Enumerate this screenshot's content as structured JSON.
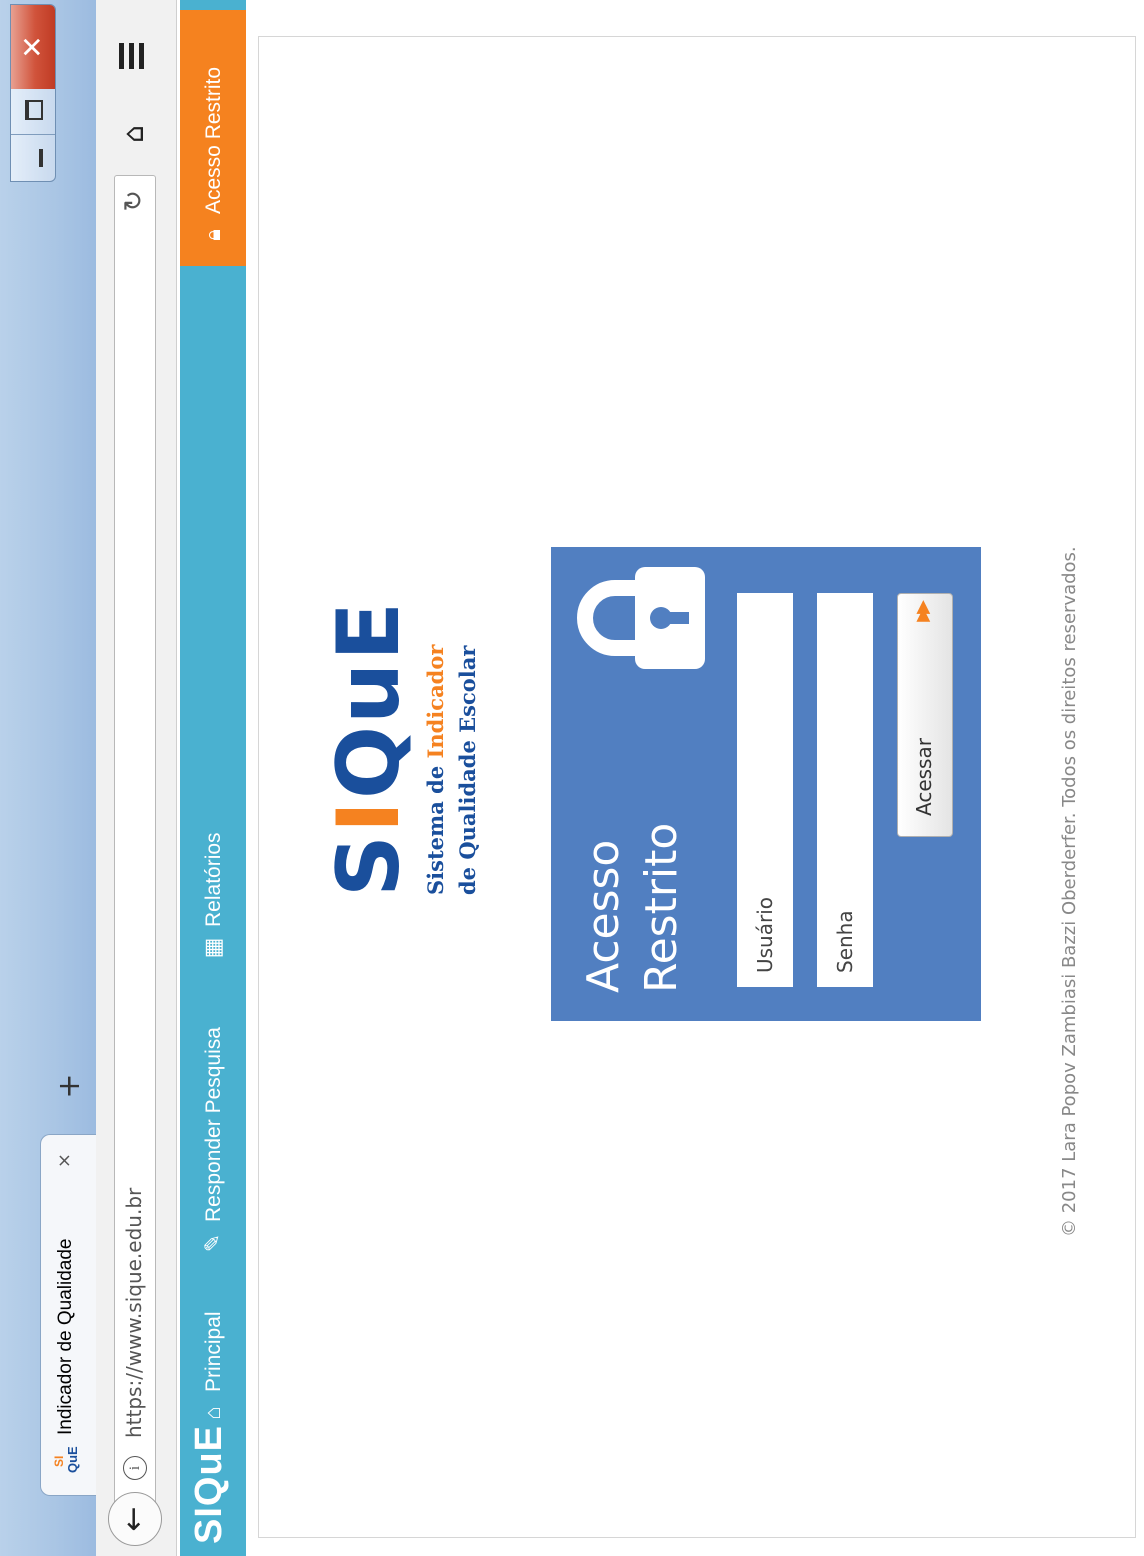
{
  "browser": {
    "tab": {
      "favicon_top": "SI",
      "favicon_bottom": "QuE",
      "title": "Indicador de Qualidade",
      "close_glyph": "×"
    },
    "new_tab_glyph": "+",
    "url": "https://www.sique.edu.br"
  },
  "site": {
    "logo": "SIQuE",
    "nav": {
      "principal": "Principal",
      "pesquisa": "Responder Pesquisa",
      "relatorios": "Relatórios",
      "restrito": "Acesso Restrito"
    }
  },
  "brand": {
    "logo_s": "S",
    "logo_i": "I",
    "logo_que": "QuE",
    "line1_pre": "Sistema de ",
    "line1_highlight": "Indicador",
    "line2": "de Qualidade Escolar"
  },
  "login": {
    "title_line1": "Acesso",
    "title_line2": "Restrito",
    "username_placeholder": "Usuário",
    "password_placeholder": "Senha",
    "button_label": "Acessar"
  },
  "footer": "© 2017 Lara Popov Zambiasi Bazzi Oberderfer. Todos os direitos reservados.",
  "colors": {
    "header": "#4ab1d0",
    "accent_orange": "#f58220",
    "login_panel": "#517fc1",
    "brand_blue": "#1a4f9c"
  }
}
